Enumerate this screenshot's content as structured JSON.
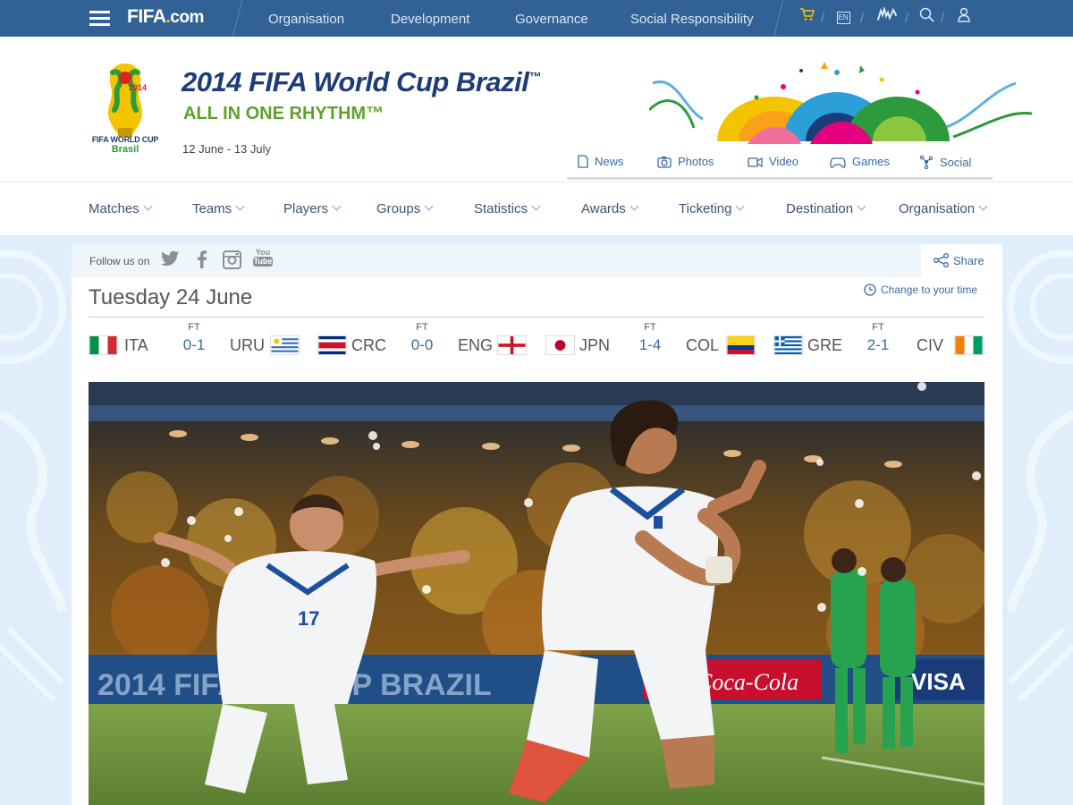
{
  "topbar": {
    "logo": "FIFA",
    "logo_domain": ".com",
    "nav": [
      "Organisation",
      "Development",
      "Governance",
      "Social Responsibility"
    ],
    "icons": [
      "cart-icon",
      "language-icon",
      "sign-language-icon",
      "search-icon",
      "user-icon"
    ],
    "language": "EN",
    "color": "#326295"
  },
  "header": {
    "title": "2014 FIFA World Cup Brazil",
    "trademark": "™",
    "subtitle": "ALL IN ONE RHYTHM™",
    "dates": "12 June - 13 July",
    "emblem_caption": "FIFA WORLD CUP",
    "emblem_caption2": "Brasil",
    "emblem_year": "2014",
    "media_tabs": [
      {
        "label": "News",
        "icon": "document-icon"
      },
      {
        "label": "Photos",
        "icon": "camera-icon"
      },
      {
        "label": "Video",
        "icon": "video-icon"
      },
      {
        "label": "Games",
        "icon": "gamepad-icon"
      },
      {
        "label": "Social",
        "icon": "network-icon"
      }
    ],
    "title_color": "#1d3c78",
    "subtitle_color": "#5da22f"
  },
  "mainnav": [
    "Matches",
    "Teams",
    "Players",
    "Groups",
    "Statistics",
    "Awards",
    "Ticketing",
    "Destination",
    "Organisation"
  ],
  "content": {
    "follow_label": "Follow us on",
    "social": [
      "twitter-icon",
      "facebook-icon",
      "instagram-icon",
      "youtube-icon"
    ],
    "youtube_text_top": "You",
    "youtube_text_bottom": "Tube",
    "share_label": "Share",
    "day_title": "Tuesday 24 June",
    "change_time": "Change to your time",
    "matches": [
      {
        "home": "ITA",
        "away": "URU",
        "status": "FT",
        "score": "0-1"
      },
      {
        "home": "CRC",
        "away": "ENG",
        "status": "FT",
        "score": "0-0"
      },
      {
        "home": "JPN",
        "away": "COL",
        "status": "FT",
        "score": "1-4"
      },
      {
        "home": "GRE",
        "away": "CIV",
        "status": "FT",
        "score": "2-1"
      }
    ],
    "photo_boards": [
      "2014 FIFA",
      "UP BRAZIL",
      "Coca-Cola",
      "VISA"
    ],
    "jersey_number": "17"
  }
}
